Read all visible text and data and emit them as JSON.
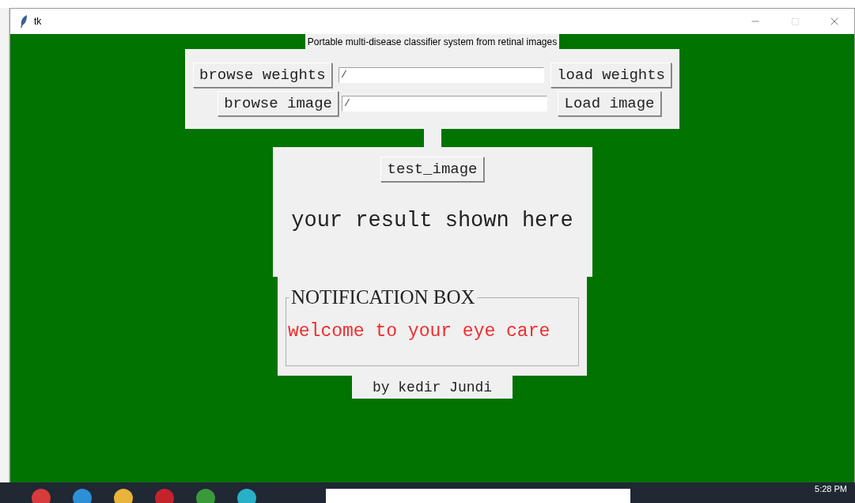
{
  "window": {
    "title": "tk"
  },
  "header": {
    "title": "Portable multi-disease classifier system from retinal images"
  },
  "file_rows": [
    {
      "browse_label": "browse weights",
      "path": "/",
      "load_label": "load weights"
    },
    {
      "browse_label": "browse image",
      "path": "/",
      "load_label": "Load image"
    }
  ],
  "test_button": "test_image",
  "result": "your result shown here",
  "notification": {
    "title": "NOTIFICATION BOX",
    "message": "welcome to your eye care"
  },
  "footer": "by kedir Jundi",
  "taskbar": {
    "clock": "5:28 PM"
  }
}
